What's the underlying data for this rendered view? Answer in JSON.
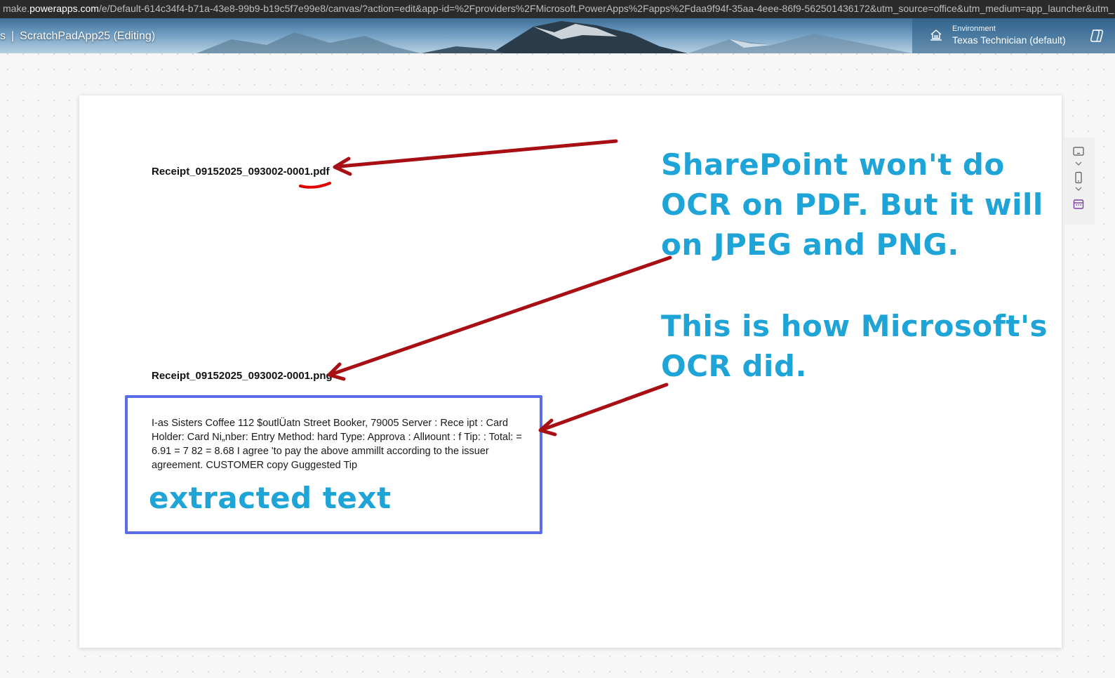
{
  "browser": {
    "url_prefix": "make.",
    "url_host": "powerapps.com",
    "url_path": "/e/Default-614c34f4-b71a-43e8-99b9-b19c5f7e99e8/canvas/?action=edit&app-id=%2Fproviders%2FMicrosoft.PowerApps%2Fapps%2Fdaa9f94f-35aa-4eee-86f9-562501436172&utm_source=office&utm_medium=app_launcher&utm_"
  },
  "header": {
    "title_prefix": "s",
    "separator": "|",
    "app_title": "ScratchPadApp25 (Editing)",
    "environment_label": "Environment",
    "environment_value": "Texas Technician (default)"
  },
  "canvas": {
    "pdf_filename": "Receipt_09152025_093002-0001.pdf",
    "png_filename": "Receipt_09152025_093002-0001.png",
    "ocr_text": "I-as Sisters Coffee 112 $outlÜatn Street Booker, 79005 Server : Rece ipt : Card Holder: Card Ni„nber: Entry Method: hard Type: Approva : Allиount : f Tip: : Total: = 6.91 = 7 82 = 8.68 I agree 'to pay the above ammillt according to the issuer agreement. CUSTOMER copy Guggested Tip",
    "extracted_label": "extracted text"
  },
  "annotations": {
    "note_1": "SharePoint won't do OCR on PDF.  But it will on JPEG and PNG.",
    "note_2": "This is how Microsoft's OCR did.",
    "text_color": "#1ea4d6",
    "arrow_color": "#a80f14",
    "box_color": "#5a6ee8"
  },
  "toolbar": {
    "icons": [
      "tablet-icon",
      "chevron-down-icon",
      "phone-icon",
      "chevron-down-icon",
      "calendar-icon"
    ]
  }
}
